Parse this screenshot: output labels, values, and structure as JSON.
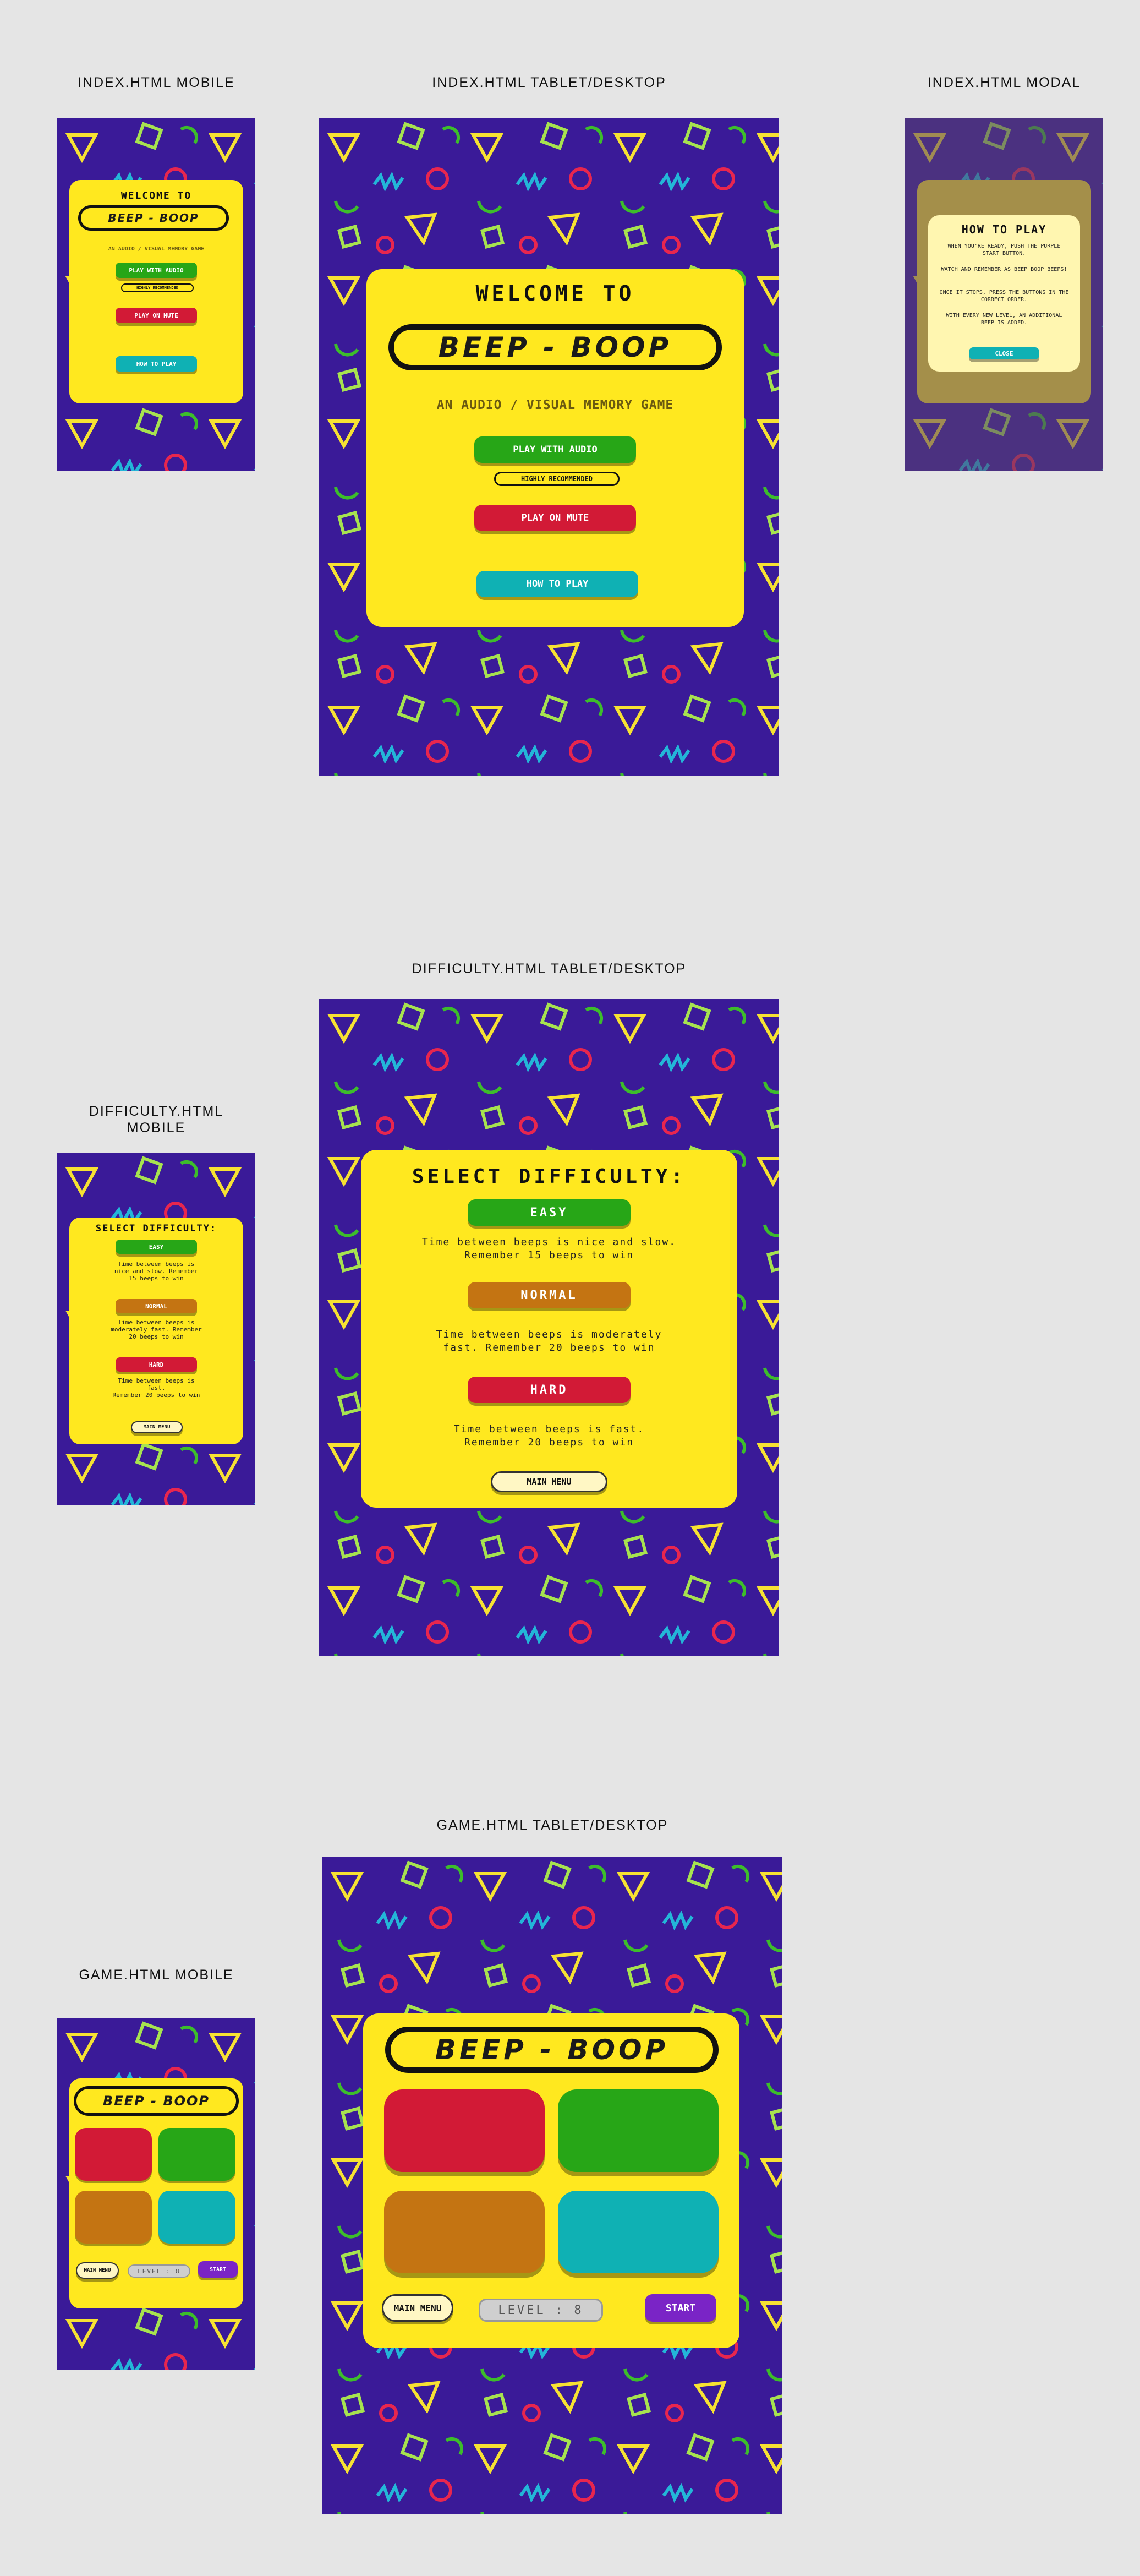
{
  "labels": {
    "index_mobile": "INDEX.HTML MOBILE",
    "index_tablet": "INDEX.HTML TABLET/DESKTOP",
    "index_modal": "INDEX.HTML MODAL",
    "difficulty_tablet": "DIFFICULTY.HTML TABLET/DESKTOP",
    "difficulty_mobile": "DIFFICULTY.HTML\nMOBILE",
    "game_tablet": "GAME.HTML TABLET/DESKTOP",
    "game_mobile": "GAME.HTML MOBILE"
  },
  "index": {
    "welcome": "WELCOME TO",
    "logo": "BEEP - BOOP",
    "subtitle": "AN AUDIO / VISUAL MEMORY GAME",
    "play_audio": "PLAY WITH AUDIO",
    "recommended": "HIGHLY RECOMMENDED",
    "play_mute": "PLAY ON MUTE",
    "how_to": "HOW TO PLAY"
  },
  "modal": {
    "title": "HOW TO PLAY",
    "p1": "WHEN YOU'RE READY, PUSH THE PURPLE START BUTTON.",
    "p2": "WATCH AND REMEMBER AS BEEP BOOP BEEPS!",
    "p3": "ONCE IT STOPS, PRESS THE BUTTONS IN THE CORRECT ORDER.",
    "p4": "WITH EVERY NEW LEVEL, AN ADDITIONAL BEEP IS ADDED.",
    "close": "CLOSE"
  },
  "difficulty": {
    "title": "SELECT DIFFICULTY:",
    "easy": "EASY",
    "easy_desc": "Time between beeps is nice and slow.\nRemember 15 beeps to win",
    "normal": "NORMAL",
    "normal_desc": "Time between beeps is moderately\nfast. Remember 20 beeps to win",
    "hard": "HARD",
    "hard_desc": "Time between beeps is fast.\nRemember 20 beeps to win",
    "main_menu": "MAIN MENU",
    "m_easy_desc": "Time between beeps is\nnice and slow. Remember\n15 beeps to win",
    "m_normal_desc": "Time between beeps is\nmoderately fast. Remember\n20 beeps to win",
    "m_hard_desc": "Time between beeps is\nfast.\nRemember 20 beeps to win"
  },
  "game": {
    "logo": "BEEP - BOOP",
    "main_menu": "MAIN MENU",
    "level": "LEVEL : 8",
    "start": "START"
  },
  "colors": {
    "background": "#3a1a98",
    "card": "#ffe81f",
    "green": "#27a617",
    "red": "#d21a36",
    "teal": "#0fb1b4",
    "orange": "#c47412",
    "purple": "#7a24c6"
  }
}
